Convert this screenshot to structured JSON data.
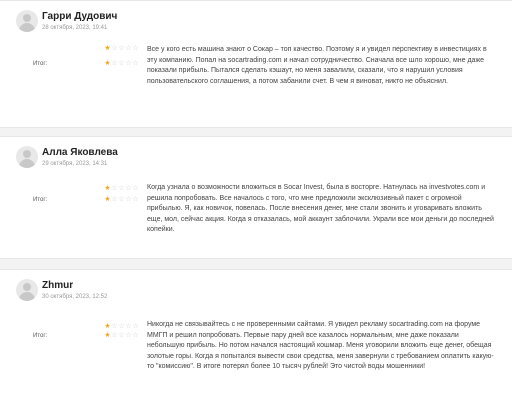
{
  "reviews": [
    {
      "name": "Гарри Дудович",
      "date": "28 октября, 2023, 19:41",
      "top_rating": 1,
      "total_label": "Итог:",
      "total_rating": 1,
      "text": "Все у кого есть машина знают о Сокар – топ качество. Поэтому я и увидел перспективу в инвестициях в эту компанию. Попал на socartrading.com и начал сотрудничество. Сначала все шло хорошо, мне даже показали прибыль. Пытался сделать кэшаут, но меня завалили, сказали, что я нарушил условия пользовательского соглашения, а потом забанили счет. В чем я виноват, никто не объяснил."
    },
    {
      "name": "Алла Яковлева",
      "date": "29 октября, 2023, 14:31",
      "top_rating": 1,
      "total_label": "Итог:",
      "total_rating": 1,
      "text": "Когда узнала о возможности вложиться в Socar Invest, была в восторге. Натнулась на investvotes.com и решила попробовать. Все началось с того, что мне предложили эксклюзивный пакет с огромной прибылью. Я, как новичок, повелась. После внесения денег, мне стали звонить и уговаривать вложить еще, мол, сейчас акция. Когда я отказалась, мой аккаунт заблочили. Украли все мои деньги до последней копейки."
    },
    {
      "name": "Zhmur",
      "date": "30 октября, 2023, 12:52",
      "top_rating": 1,
      "total_label": "Итог:",
      "total_rating": 1,
      "text": "Никогда не связывайтесь с не проверенными сайтами. Я увидел рекламу socartrading.com на форуме ММГП и решил попробовать. Первые пару дней все казалось нормальным, мне даже показали небольшую прибыль. Но потом начался настоящий кошмар. Меня уговорили вложить еще денег, обещая золотые горы. Когда я попытался вывести свои средства, меня завернули с требованием оплатить какую-то \"комиссию\". В итоге потерял более 10 тысяч рублей! Это чистой воды мошенники!"
    }
  ],
  "star_max": 5,
  "colors": {
    "star_on": "#f2a81d",
    "star_off": "#d0d0d0",
    "background": "#f3f3f3"
  }
}
